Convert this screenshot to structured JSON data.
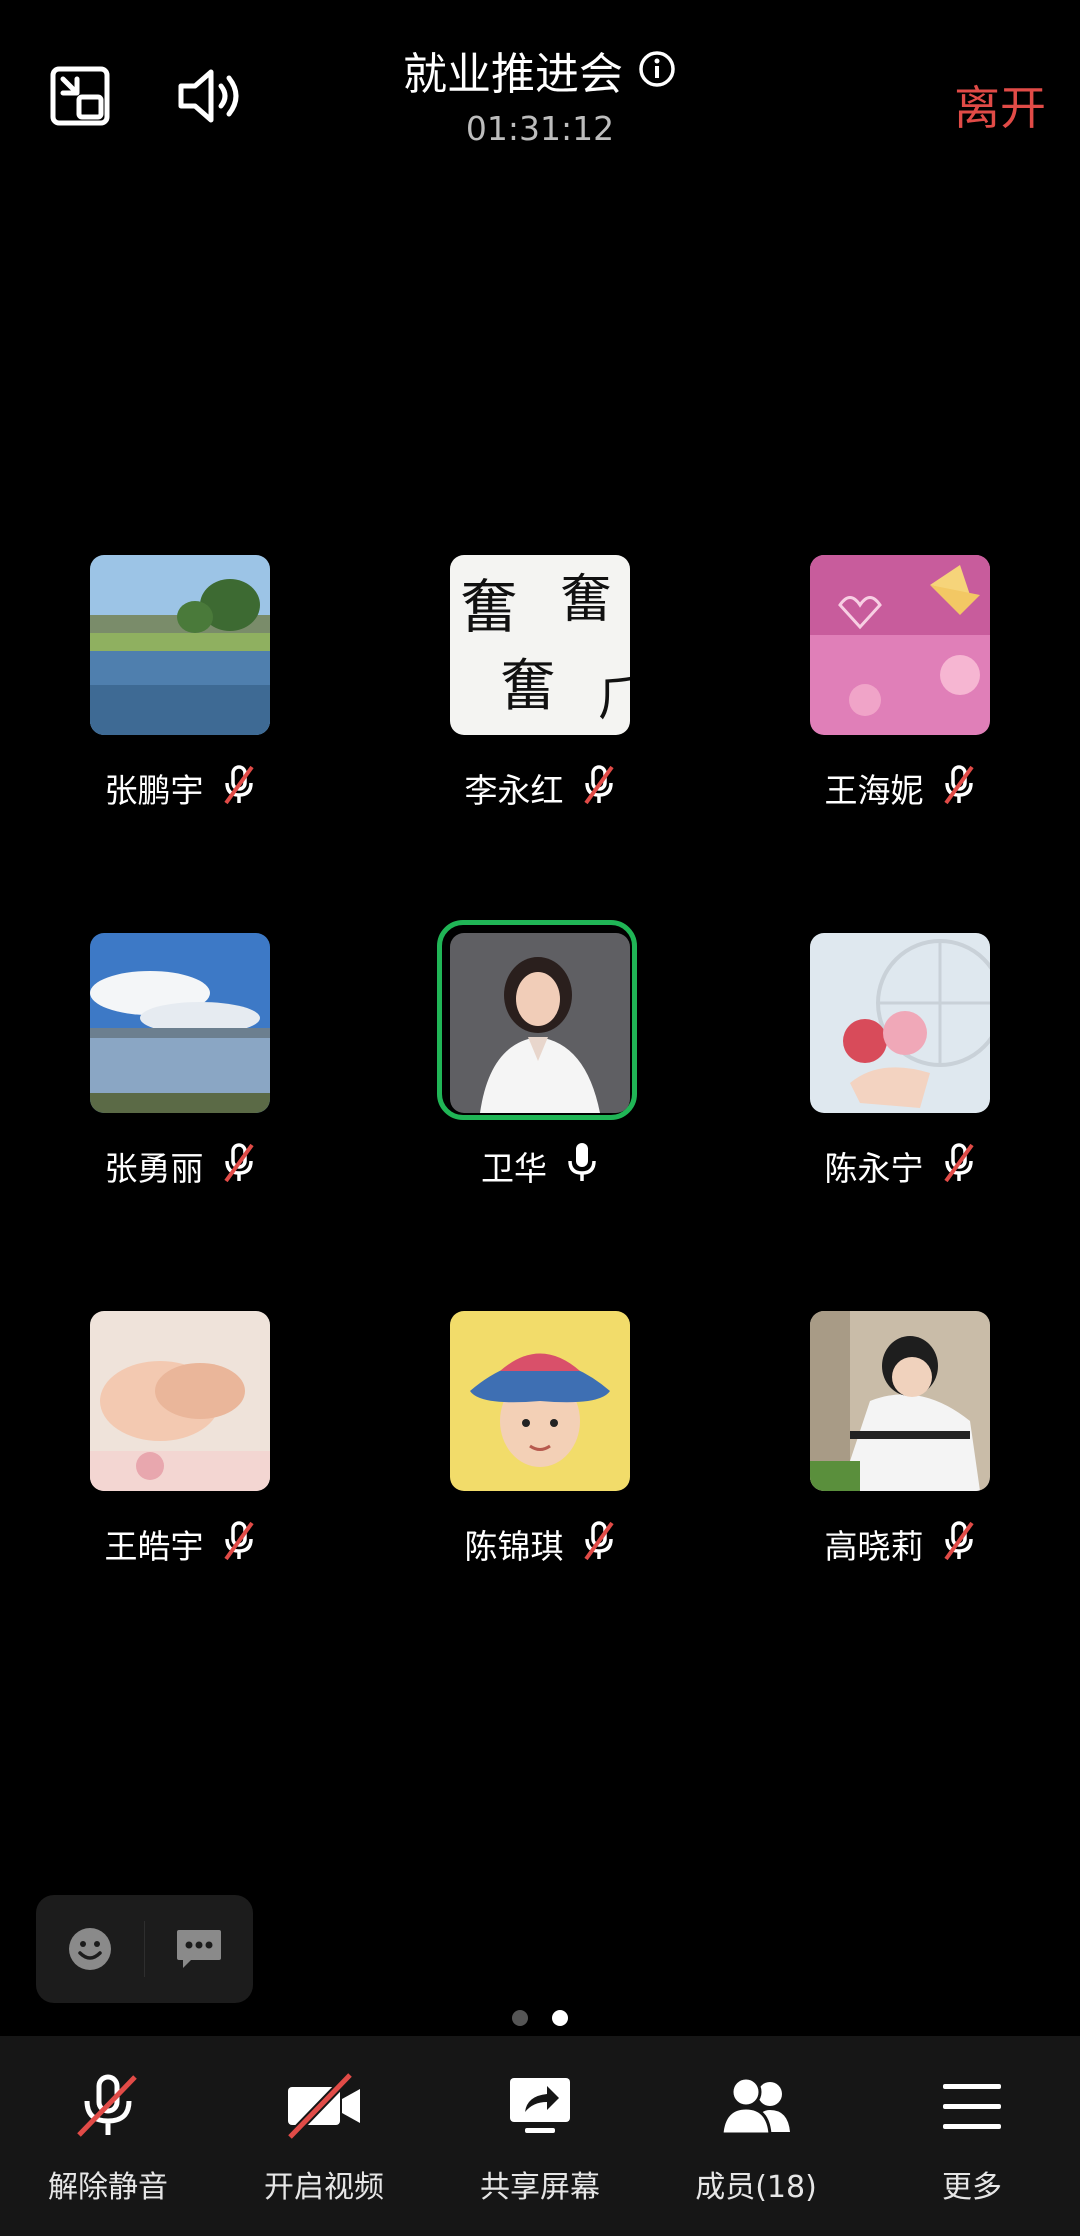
{
  "header": {
    "title": "就业推进会",
    "timer": "01:31:12",
    "leave_label": "离开"
  },
  "participants": [
    {
      "name": "张鹏宇",
      "muted": true,
      "avatar": "lake-landscape"
    },
    {
      "name": "李永红",
      "muted": true,
      "avatar": "calligraphy"
    },
    {
      "name": "王海妮",
      "muted": true,
      "avatar": "pink-butterfly"
    },
    {
      "name": "张勇丽",
      "muted": true,
      "avatar": "sky-lake"
    },
    {
      "name": "卫华",
      "muted": false,
      "avatar": "woman-portrait",
      "speaking": true
    },
    {
      "name": "陈永宁",
      "muted": true,
      "avatar": "plush-bears"
    },
    {
      "name": "王皓宇",
      "muted": true,
      "avatar": "holding-hands"
    },
    {
      "name": "陈锦琪",
      "muted": true,
      "avatar": "child-hat"
    },
    {
      "name": "高晓莉",
      "muted": true,
      "avatar": "child-photo"
    }
  ],
  "pager": {
    "pages": 2,
    "current": 2
  },
  "toolbar": {
    "unmute": "解除静音",
    "video": "开启视频",
    "share": "共享屏幕",
    "members": "成员(18)",
    "more": "更多"
  },
  "colors": {
    "accent_green": "#20b556",
    "leave_red": "#e14b47",
    "toolbar_bg": "#161616"
  }
}
